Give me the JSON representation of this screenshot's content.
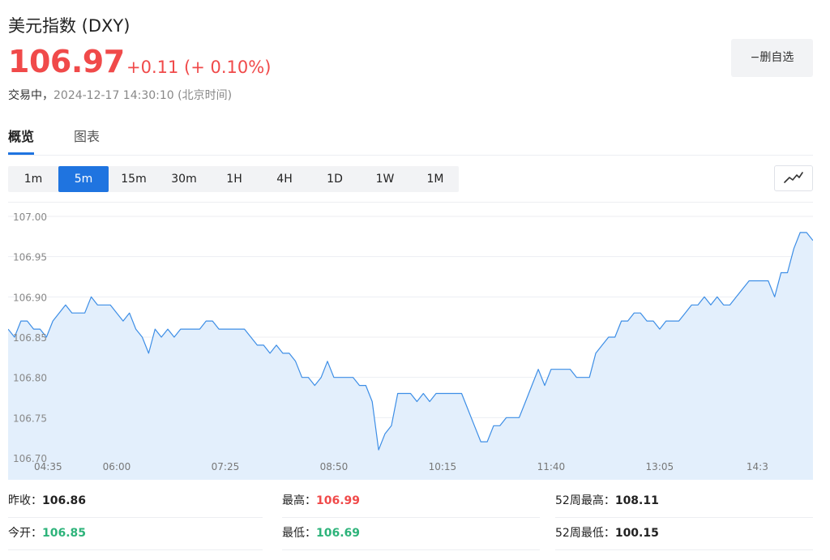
{
  "header": {
    "title": "美元指数 (DXY)",
    "price": "106.97",
    "change": "+0.11 (+ 0.10%)",
    "status_label": "交易中，",
    "timestamp": "2024-12-17 14:30:10 (北京时间)",
    "watchlist_button": "−删自选"
  },
  "tabs": [
    {
      "label": "概览",
      "active": true
    },
    {
      "label": "图表",
      "active": false
    }
  ],
  "periods": [
    {
      "label": "1m",
      "active": false
    },
    {
      "label": "5m",
      "active": true
    },
    {
      "label": "15m",
      "active": false
    },
    {
      "label": "30m",
      "active": false
    },
    {
      "label": "1H",
      "active": false
    },
    {
      "label": "4H",
      "active": false
    },
    {
      "label": "1D",
      "active": false
    },
    {
      "label": "1W",
      "active": false
    },
    {
      "label": "1M",
      "active": false
    }
  ],
  "chart_type_icon": "line-chart-icon",
  "colors": {
    "up": "#f04a4a",
    "down": "#2db37a",
    "accent": "#1f74e0",
    "line": "#3d8ee6",
    "area": "#e3effc"
  },
  "chart_data": {
    "type": "area",
    "title": "",
    "xlabel": "",
    "ylabel": "",
    "ylim": [
      106.7,
      107.0
    ],
    "grid": true,
    "y_ticks": [
      "107.00",
      "106.95",
      "106.90",
      "106.85",
      "106.80",
      "106.75",
      "106.70"
    ],
    "x_ticks": [
      "04:35",
      "06:00",
      "07:25",
      "08:50",
      "10:15",
      "11:40",
      "13:05",
      "14:3"
    ],
    "x_tick_positions": [
      0,
      17,
      34,
      51,
      68,
      85,
      102,
      119
    ],
    "series": [
      {
        "values": [
          106.86,
          106.85,
          106.87,
          106.87,
          106.86,
          106.86,
          106.85,
          106.87,
          106.88,
          106.89,
          106.88,
          106.88,
          106.88,
          106.9,
          106.89,
          106.89,
          106.89,
          106.88,
          106.87,
          106.88,
          106.86,
          106.85,
          106.83,
          106.86,
          106.85,
          106.86,
          106.85,
          106.86,
          106.86,
          106.86,
          106.86,
          106.87,
          106.87,
          106.86,
          106.86,
          106.86,
          106.86,
          106.86,
          106.85,
          106.84,
          106.84,
          106.83,
          106.84,
          106.83,
          106.83,
          106.82,
          106.8,
          106.8,
          106.79,
          106.8,
          106.82,
          106.8,
          106.8,
          106.8,
          106.8,
          106.79,
          106.79,
          106.77,
          106.71,
          106.73,
          106.74,
          106.78,
          106.78,
          106.78,
          106.77,
          106.78,
          106.77,
          106.78,
          106.78,
          106.78,
          106.78,
          106.78,
          106.76,
          106.74,
          106.72,
          106.72,
          106.74,
          106.74,
          106.75,
          106.75,
          106.75,
          106.77,
          106.79,
          106.81,
          106.79,
          106.81,
          106.81,
          106.81,
          106.81,
          106.8,
          106.8,
          106.8,
          106.83,
          106.84,
          106.85,
          106.85,
          106.87,
          106.87,
          106.88,
          106.88,
          106.87,
          106.87,
          106.86,
          106.87,
          106.87,
          106.87,
          106.88,
          106.89,
          106.89,
          106.9,
          106.89,
          106.9,
          106.89,
          106.89,
          106.9,
          106.91,
          106.92,
          106.92,
          106.92,
          106.92,
          106.9,
          106.93,
          106.93,
          106.96,
          106.98,
          106.98,
          106.97
        ]
      }
    ]
  },
  "stats": [
    {
      "label": "昨收：",
      "value": "106.86",
      "tone": "dark"
    },
    {
      "label": "最高：",
      "value": "106.99",
      "tone": "red"
    },
    {
      "label": "52周最高：",
      "value": "108.11",
      "tone": "dark"
    },
    {
      "label": "今开：",
      "value": "106.85",
      "tone": "green"
    },
    {
      "label": "最低：",
      "value": "106.69",
      "tone": "green"
    },
    {
      "label": "52周最低：",
      "value": "100.15",
      "tone": "dark"
    }
  ]
}
